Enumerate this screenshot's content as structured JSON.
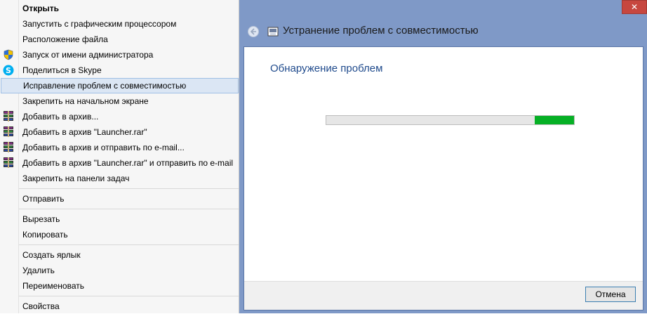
{
  "context_menu": {
    "items": [
      {
        "label": "Открыть",
        "icon": "",
        "bold": true
      },
      {
        "label": "Запустить с графическим процессором",
        "icon": ""
      },
      {
        "label": "Расположение файла",
        "icon": ""
      },
      {
        "label": "Запуск от имени администратора",
        "icon": "uac-shield-icon"
      },
      {
        "label": "Поделиться в Skype",
        "icon": "skype-icon"
      },
      {
        "label": "Исправление проблем с совместимостью",
        "icon": "",
        "highlighted": true
      },
      {
        "label": "Закрепить на начальном экране",
        "icon": ""
      },
      {
        "label": "Добавить в архив...",
        "icon": "winrar-icon"
      },
      {
        "label": "Добавить в архив \"Launcher.rar\"",
        "icon": "winrar-icon"
      },
      {
        "label": "Добавить в архив и отправить по e-mail...",
        "icon": "winrar-icon"
      },
      {
        "label": "Добавить в архив \"Launcher.rar\" и отправить по e-mail",
        "icon": "winrar-icon"
      },
      {
        "label": "Закрепить на панели задач",
        "icon": ""
      },
      {
        "label": "Отправить",
        "icon": ""
      },
      {
        "label": "Вырезать",
        "icon": ""
      },
      {
        "label": "Копировать",
        "icon": ""
      },
      {
        "label": "Создать ярлык",
        "icon": ""
      },
      {
        "label": "Удалить",
        "icon": ""
      },
      {
        "label": "Переименовать",
        "icon": ""
      },
      {
        "label": "Свойства",
        "icon": ""
      }
    ]
  },
  "troubleshooter": {
    "title": "Устранение проблем с совместимостью",
    "heading": "Обнаружение проблем",
    "progress_indeterminate": true,
    "cancel_label": "Отмена",
    "close_glyph": "✕"
  },
  "colors": {
    "window_frame": "#7f99c7",
    "progress_green": "#06b025",
    "heading_blue": "#1f4a8c",
    "close_red": "#c7473f"
  }
}
